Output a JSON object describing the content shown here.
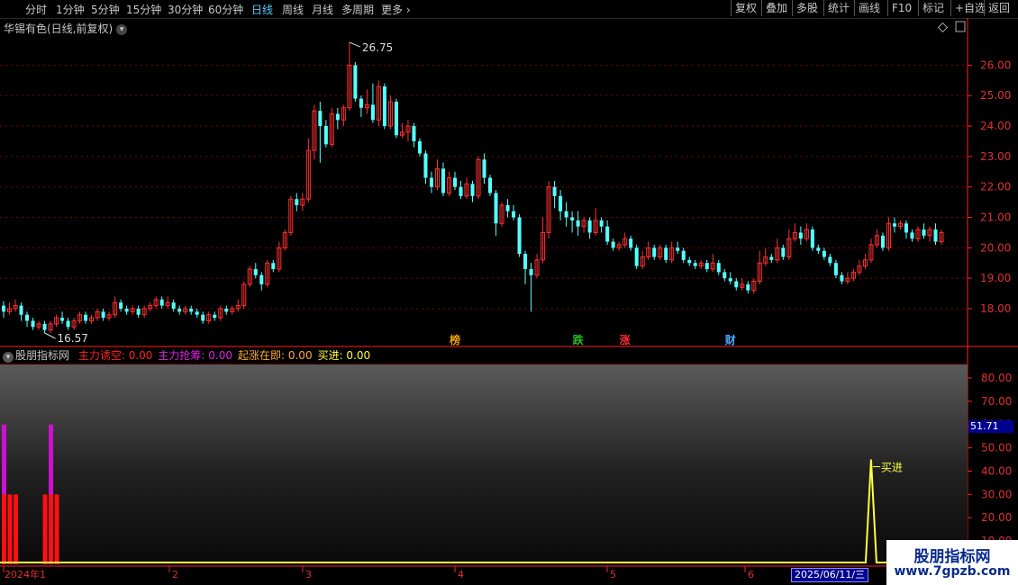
{
  "toolbar": {
    "periods": [
      "分时",
      "1分钟",
      "5分钟",
      "15分钟",
      "30分钟",
      "60分钟",
      "日线",
      "周线",
      "月线",
      "多周期",
      "更多"
    ],
    "active": "日线",
    "more_chevron": "›",
    "right_buttons": [
      "复权",
      "叠加",
      "多股",
      "统计",
      "画线",
      "F10",
      "标记",
      "+自选",
      "返回"
    ]
  },
  "stock": {
    "title": "华锡有色(日线,前复权)",
    "high_label": "26.75",
    "low_label": "16.57"
  },
  "price_axis": [
    "26.00",
    "25.00",
    "24.00",
    "23.00",
    "22.00",
    "21.00",
    "20.00",
    "19.00",
    "18.00"
  ],
  "event_markers": [
    {
      "text": "榜",
      "color": "#f0a000",
      "day": 77
    },
    {
      "text": "跌",
      "color": "#20c020",
      "day": 98
    },
    {
      "text": "涨",
      "color": "#ff3030",
      "day": 106
    },
    {
      "text": "财",
      "color": "#4aa8ff",
      "day": 124
    }
  ],
  "indicator": {
    "name": "股朋指标网",
    "items": [
      {
        "label": "主力诱空:",
        "value": "0.00",
        "color": "#ff2020"
      },
      {
        "label": "主力抢筹:",
        "value": "0.00",
        "color": "#e020e0"
      },
      {
        "label": "起涨在即:",
        "value": "0.00",
        "color": "#ffaa33"
      },
      {
        "label": "买进:",
        "value": "0.00",
        "color": "#ffff40"
      }
    ],
    "axis": [
      "80.00",
      "70.00",
      "60.00",
      "50.00",
      "40.00",
      "30.00",
      "20.00",
      "10.00"
    ],
    "current_value": "51.71",
    "buy_label": "买进"
  },
  "x_axis": {
    "labels": [
      "2024年1",
      "2",
      "3",
      "4",
      "5",
      "6"
    ],
    "cursor_date": "2025/06/11/三"
  },
  "watermark": {
    "line1": "股朋指标网",
    "line2": "www.7gpzb.com"
  },
  "colors": {
    "up": "#ff3030",
    "down": "#54ffff",
    "grid": "#8b0000",
    "axis": "#ff2020",
    "buy": "#ffff40",
    "lure": "#ff1010",
    "grab": "#d010d0"
  },
  "chart_data": {
    "type": "candlestick",
    "y_range": [
      17.2,
      26.9
    ],
    "candles": [
      [
        18.1,
        17.9,
        18.25,
        17.7
      ],
      [
        17.9,
        18.0,
        18.2,
        17.8
      ],
      [
        18.0,
        18.1,
        18.3,
        17.9
      ],
      [
        18.1,
        17.8,
        18.2,
        17.6
      ],
      [
        17.8,
        17.6,
        17.9,
        17.4
      ],
      [
        17.6,
        17.4,
        17.7,
        17.3
      ],
      [
        17.4,
        17.5,
        17.6,
        17.3
      ],
      [
        17.5,
        17.3,
        17.6,
        17.2
      ],
      [
        17.3,
        17.5,
        17.6,
        17.2
      ],
      [
        17.5,
        17.7,
        17.8,
        17.4
      ],
      [
        17.7,
        17.6,
        17.9,
        17.5
      ],
      [
        17.6,
        17.4,
        17.7,
        17.3
      ],
      [
        17.4,
        17.6,
        17.7,
        17.3
      ],
      [
        17.6,
        17.8,
        17.9,
        17.5
      ],
      [
        17.8,
        17.6,
        17.9,
        17.5
      ],
      [
        17.6,
        17.7,
        17.8,
        17.5
      ],
      [
        17.7,
        17.9,
        18.0,
        17.6
      ],
      [
        17.9,
        17.7,
        18.0,
        17.6
      ],
      [
        17.7,
        17.8,
        17.9,
        17.6
      ],
      [
        17.8,
        18.2,
        18.4,
        17.7
      ],
      [
        18.2,
        18.0,
        18.3,
        17.9
      ],
      [
        18.0,
        17.9,
        18.1,
        17.8
      ],
      [
        17.9,
        18.0,
        18.1,
        17.8
      ],
      [
        18.0,
        17.8,
        18.1,
        17.7
      ],
      [
        17.8,
        18.0,
        18.1,
        17.7
      ],
      [
        18.0,
        18.1,
        18.2,
        17.9
      ],
      [
        18.1,
        18.3,
        18.4,
        18.0
      ],
      [
        18.3,
        18.1,
        18.4,
        18.0
      ],
      [
        18.1,
        18.2,
        18.4,
        18.0
      ],
      [
        18.2,
        18.0,
        18.3,
        17.9
      ],
      [
        18.0,
        17.9,
        18.1,
        17.8
      ],
      [
        17.9,
        18.0,
        18.1,
        17.8
      ],
      [
        18.0,
        17.9,
        18.1,
        17.8
      ],
      [
        17.9,
        17.8,
        18.0,
        17.7
      ],
      [
        17.8,
        17.6,
        17.9,
        17.5
      ],
      [
        17.6,
        17.8,
        17.9,
        17.5
      ],
      [
        17.8,
        17.7,
        17.9,
        17.6
      ],
      [
        17.7,
        18.0,
        18.1,
        17.6
      ],
      [
        18.0,
        17.9,
        18.1,
        17.8
      ],
      [
        17.9,
        18.0,
        18.1,
        17.8
      ],
      [
        18.0,
        18.1,
        18.3,
        17.9
      ],
      [
        18.1,
        18.8,
        18.9,
        18.0
      ],
      [
        18.8,
        19.3,
        19.4,
        18.7
      ],
      [
        19.3,
        19.1,
        19.5,
        19.0
      ],
      [
        19.1,
        18.8,
        19.2,
        18.6
      ],
      [
        18.8,
        19.5,
        19.6,
        18.7
      ],
      [
        19.5,
        19.3,
        19.6,
        19.2
      ],
      [
        19.3,
        20.0,
        20.2,
        19.2
      ],
      [
        20.0,
        20.5,
        20.6,
        19.9
      ],
      [
        20.5,
        21.6,
        21.7,
        20.4
      ],
      [
        21.6,
        21.4,
        21.8,
        21.2
      ],
      [
        21.4,
        21.6,
        21.8,
        21.2
      ],
      [
        21.6,
        23.2,
        23.6,
        21.5
      ],
      [
        23.2,
        24.5,
        24.7,
        22.9
      ],
      [
        24.5,
        24.0,
        24.8,
        22.8
      ],
      [
        24.0,
        23.4,
        24.2,
        23.3
      ],
      [
        23.4,
        24.4,
        24.6,
        23.3
      ],
      [
        24.4,
        24.2,
        24.6,
        23.9
      ],
      [
        24.2,
        24.6,
        24.7,
        24.0
      ],
      [
        24.6,
        26.0,
        26.75,
        24.5
      ],
      [
        26.0,
        24.9,
        26.1,
        24.8
      ],
      [
        24.9,
        24.6,
        25.0,
        24.3
      ],
      [
        24.6,
        24.7,
        25.2,
        24.4
      ],
      [
        24.7,
        24.2,
        25.4,
        24.1
      ],
      [
        24.2,
        25.3,
        25.5,
        24.0
      ],
      [
        25.3,
        24.0,
        25.4,
        23.9
      ],
      [
        24.0,
        24.8,
        25.0,
        23.9
      ],
      [
        24.8,
        23.7,
        24.9,
        23.6
      ],
      [
        23.7,
        23.8,
        24.1,
        23.6
      ],
      [
        23.8,
        24.0,
        24.2,
        23.5
      ],
      [
        24.0,
        23.5,
        24.1,
        23.3
      ],
      [
        23.5,
        23.1,
        23.6,
        23.0
      ],
      [
        23.1,
        22.3,
        23.2,
        22.1
      ],
      [
        22.3,
        22.0,
        22.5,
        21.8
      ],
      [
        22.0,
        22.6,
        22.9,
        21.9
      ],
      [
        22.6,
        21.8,
        22.8,
        21.7
      ],
      [
        21.8,
        22.3,
        22.5,
        21.7
      ],
      [
        22.3,
        22.0,
        22.5,
        21.9
      ],
      [
        22.0,
        21.7,
        22.2,
        21.6
      ],
      [
        21.7,
        22.1,
        22.3,
        21.6
      ],
      [
        22.1,
        21.7,
        22.2,
        21.5
      ],
      [
        21.7,
        22.9,
        23.0,
        21.6
      ],
      [
        22.9,
        22.3,
        23.1,
        22.1
      ],
      [
        22.3,
        21.8,
        22.4,
        21.7
      ],
      [
        21.8,
        20.8,
        21.9,
        20.4
      ],
      [
        20.8,
        21.4,
        21.5,
        20.7
      ],
      [
        21.4,
        21.2,
        21.6,
        21.0
      ],
      [
        21.2,
        21.0,
        21.4,
        20.9
      ],
      [
        21.0,
        19.8,
        21.1,
        19.7
      ],
      [
        19.8,
        19.3,
        19.9,
        18.8
      ],
      [
        19.3,
        19.1,
        19.5,
        17.9
      ],
      [
        19.1,
        19.6,
        19.8,
        19.0
      ],
      [
        19.6,
        20.5,
        21.0,
        19.5
      ],
      [
        20.5,
        22.0,
        22.2,
        20.3
      ],
      [
        22.0,
        21.7,
        22.2,
        21.3
      ],
      [
        21.7,
        21.2,
        21.9,
        20.9
      ],
      [
        21.2,
        21.0,
        21.5,
        20.7
      ],
      [
        21.0,
        20.9,
        21.2,
        20.5
      ],
      [
        20.9,
        20.7,
        21.2,
        20.4
      ],
      [
        20.7,
        20.9,
        21.0,
        20.5
      ],
      [
        20.9,
        20.5,
        21.0,
        20.3
      ],
      [
        20.5,
        20.9,
        21.3,
        20.4
      ],
      [
        20.9,
        20.7,
        21.0,
        20.5
      ],
      [
        20.7,
        20.2,
        20.9,
        20.1
      ],
      [
        20.2,
        20.0,
        20.3,
        19.9
      ],
      [
        20.0,
        20.1,
        20.2,
        19.9
      ],
      [
        20.1,
        20.3,
        20.5,
        20.0
      ],
      [
        20.3,
        20.0,
        20.4,
        19.9
      ],
      [
        20.0,
        19.4,
        20.1,
        19.3
      ],
      [
        19.4,
        19.7,
        19.9,
        19.3
      ],
      [
        19.7,
        20.0,
        20.2,
        19.6
      ],
      [
        20.0,
        19.7,
        20.1,
        19.6
      ],
      [
        19.7,
        20.0,
        20.1,
        19.6
      ],
      [
        20.0,
        19.6,
        20.1,
        19.5
      ],
      [
        19.6,
        20.0,
        20.2,
        19.5
      ],
      [
        20.0,
        19.9,
        20.2,
        19.8
      ],
      [
        19.9,
        19.6,
        20.0,
        19.5
      ],
      [
        19.6,
        19.5,
        19.7,
        19.4
      ],
      [
        19.5,
        19.4,
        19.6,
        19.3
      ],
      [
        19.4,
        19.5,
        19.6,
        19.3
      ],
      [
        19.5,
        19.3,
        19.6,
        19.2
      ],
      [
        19.3,
        19.5,
        19.8,
        19.2
      ],
      [
        19.5,
        19.2,
        19.6,
        19.1
      ],
      [
        19.2,
        19.0,
        19.3,
        18.9
      ],
      [
        19.0,
        18.9,
        19.2,
        18.8
      ],
      [
        18.9,
        18.7,
        19.0,
        18.6
      ],
      [
        18.7,
        18.8,
        19.0,
        18.6
      ],
      [
        18.8,
        18.6,
        18.9,
        18.5
      ],
      [
        18.6,
        18.9,
        19.0,
        18.5
      ],
      [
        18.9,
        19.5,
        19.9,
        18.8
      ],
      [
        19.5,
        19.7,
        20.0,
        19.4
      ],
      [
        19.7,
        19.6,
        19.8,
        19.5
      ],
      [
        19.6,
        20.0,
        20.3,
        19.5
      ],
      [
        20.0,
        19.7,
        20.1,
        19.6
      ],
      [
        19.7,
        20.3,
        20.6,
        19.6
      ],
      [
        20.3,
        20.5,
        20.8,
        20.2
      ],
      [
        20.5,
        20.3,
        20.7,
        20.1
      ],
      [
        20.3,
        20.6,
        20.8,
        20.2
      ],
      [
        20.6,
        20.0,
        20.7,
        19.9
      ],
      [
        20.0,
        19.9,
        20.1,
        19.8
      ],
      [
        19.9,
        19.7,
        20.0,
        19.6
      ],
      [
        19.7,
        19.5,
        19.8,
        19.4
      ],
      [
        19.5,
        19.1,
        19.6,
        19.0
      ],
      [
        19.1,
        18.9,
        19.2,
        18.8
      ],
      [
        18.9,
        19.0,
        19.2,
        18.8
      ],
      [
        19.0,
        19.2,
        19.3,
        18.9
      ],
      [
        19.2,
        19.4,
        19.6,
        19.1
      ],
      [
        19.4,
        19.6,
        19.8,
        19.3
      ],
      [
        19.6,
        20.1,
        20.3,
        19.5
      ],
      [
        20.1,
        20.4,
        20.6,
        20.0
      ],
      [
        20.4,
        20.0,
        20.5,
        19.9
      ],
      [
        20.0,
        20.8,
        21.0,
        19.9
      ],
      [
        20.8,
        20.7,
        21.0,
        20.5
      ],
      [
        20.7,
        20.8,
        20.9,
        20.6
      ],
      [
        20.8,
        20.5,
        20.9,
        20.3
      ],
      [
        20.5,
        20.3,
        20.6,
        20.2
      ],
      [
        20.3,
        20.6,
        20.7,
        20.2
      ],
      [
        20.6,
        20.4,
        20.8,
        20.3
      ],
      [
        20.4,
        20.6,
        20.7,
        20.2
      ],
      [
        20.6,
        20.2,
        20.8,
        20.1
      ],
      [
        20.2,
        20.5,
        20.6,
        20.1
      ]
    ],
    "indicator_series": {
      "lure_bars": [
        {
          "day": 0,
          "value": 30
        },
        {
          "day": 1,
          "value": 30
        },
        {
          "day": 2,
          "value": 30
        },
        {
          "day": 7,
          "value": 30
        },
        {
          "day": 8,
          "value": 30
        },
        {
          "day": 9,
          "value": 30
        }
      ],
      "grab_bars": [
        {
          "day": 0,
          "value": 60
        },
        {
          "day": 8,
          "value": 60
        }
      ],
      "buy_spike": {
        "day": 148,
        "value": 45
      }
    },
    "indicator_y_range": [
      0,
      85
    ]
  }
}
